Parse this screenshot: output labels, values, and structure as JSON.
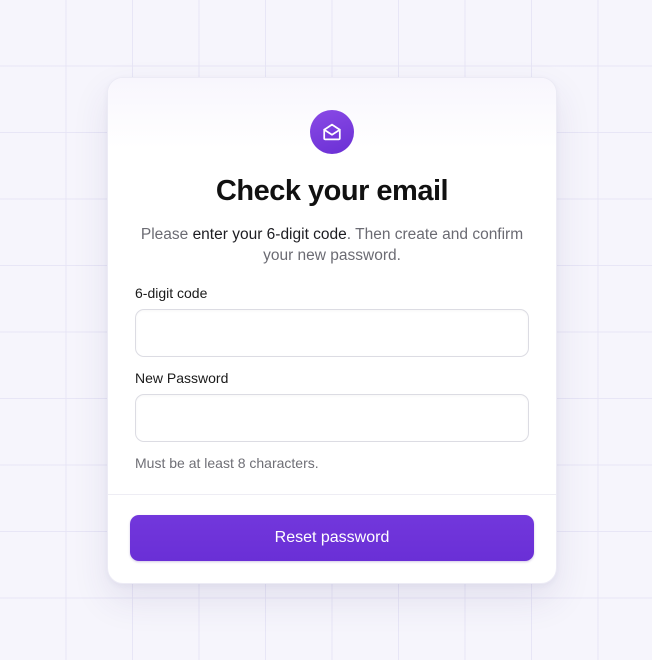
{
  "card": {
    "title": "Check your email",
    "subtitle": {
      "before": "Please ",
      "emphasis": "enter your 6-digit code",
      "after": ". Then create and confirm your new password."
    }
  },
  "form": {
    "code": {
      "label": "6-digit code",
      "value": "",
      "placeholder": ""
    },
    "password": {
      "label": "New Password",
      "value": "",
      "placeholder": "",
      "hint": "Must be at least 8 characters."
    },
    "submit_label": "Reset password"
  },
  "icons": {
    "brand": "mail-open-icon"
  },
  "colors": {
    "accent": "#6d33d8",
    "background": "#f6f5fc",
    "card": "#ffffff",
    "text": "#111111",
    "muted": "#6b6b73"
  }
}
